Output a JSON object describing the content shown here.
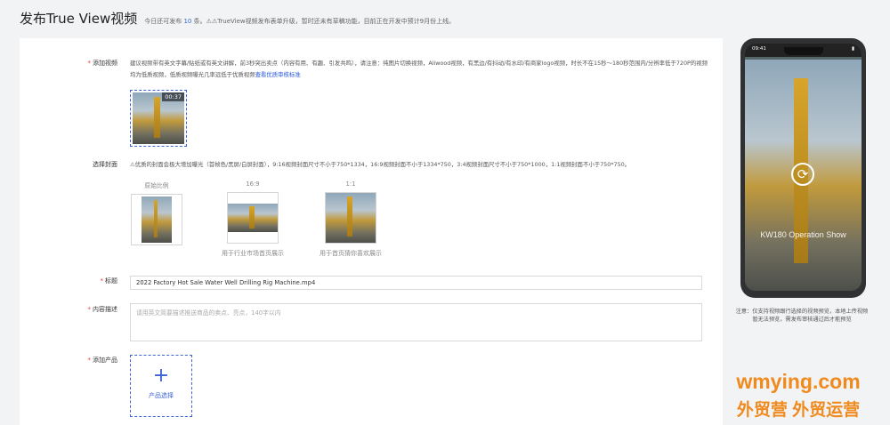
{
  "header": {
    "title": "发布True View视频",
    "sub_prefix": "今日还可发布",
    "sub_count": "10",
    "sub_suffix": "条。⚠⚠TrueView视频发布表单升级，暂时还未有草稿功能，目前正在开发中预计9月份上线。"
  },
  "form": {
    "video": {
      "label": "添加视频",
      "hint": "建议视频带有英文字幕/贴纸或有英文讲解，前3秒突出卖点（内容有用、有趣、引发共鸣），请注意：纯图片切换视频，Aliwood视频，有黑边/有抖动/有水印/有商家logo视频，时长不在15秒～180秒范围内/分辨率低于720P的视频均为低质视频，低质视频曝光几率远低于优质视频",
      "hint_link": "查看优质审核标准",
      "duration": "00:37"
    },
    "cover": {
      "label": "选择封面",
      "hint": "⚠优质的封面会极大增加曝光（首帧色/黑屏/白屏封面），9:16视频封面尺寸不小于750*1334，16:9视频封面不小于1334*750，3:4视频封面尺寸不小于750*1000，1:1视频封面不小于750*750。",
      "options": [
        {
          "ratio": "原始比例",
          "note": ""
        },
        {
          "ratio": "16:9",
          "note": "用于行业市场首页展示"
        },
        {
          "ratio": "1:1",
          "note": "用于首页猜你喜欢展示"
        }
      ]
    },
    "title": {
      "label": "标题",
      "value": "2022 Factory Hot Sale Water Well Drilling Rig Machine.mp4"
    },
    "description": {
      "label": "内容描述",
      "placeholder": "请用英文简要描述推送商品的卖点、亮点，140字以内"
    },
    "product": {
      "label": "添加产品",
      "plus": "+",
      "button": "产品选择"
    }
  },
  "preview": {
    "time": "09:41",
    "caption": "KW180 Operation Show",
    "note": "注意：仅支持视频跟行选择的视频预览，本地上传视频暂无法预览，需发布审核通过后才能预览"
  },
  "watermark": {
    "line1": "wmying.com",
    "line2": "外贸营 外贸运营"
  },
  "colors": {
    "accent": "#3b62d6",
    "required": "#e33333",
    "watermark": "#f08a1c"
  }
}
